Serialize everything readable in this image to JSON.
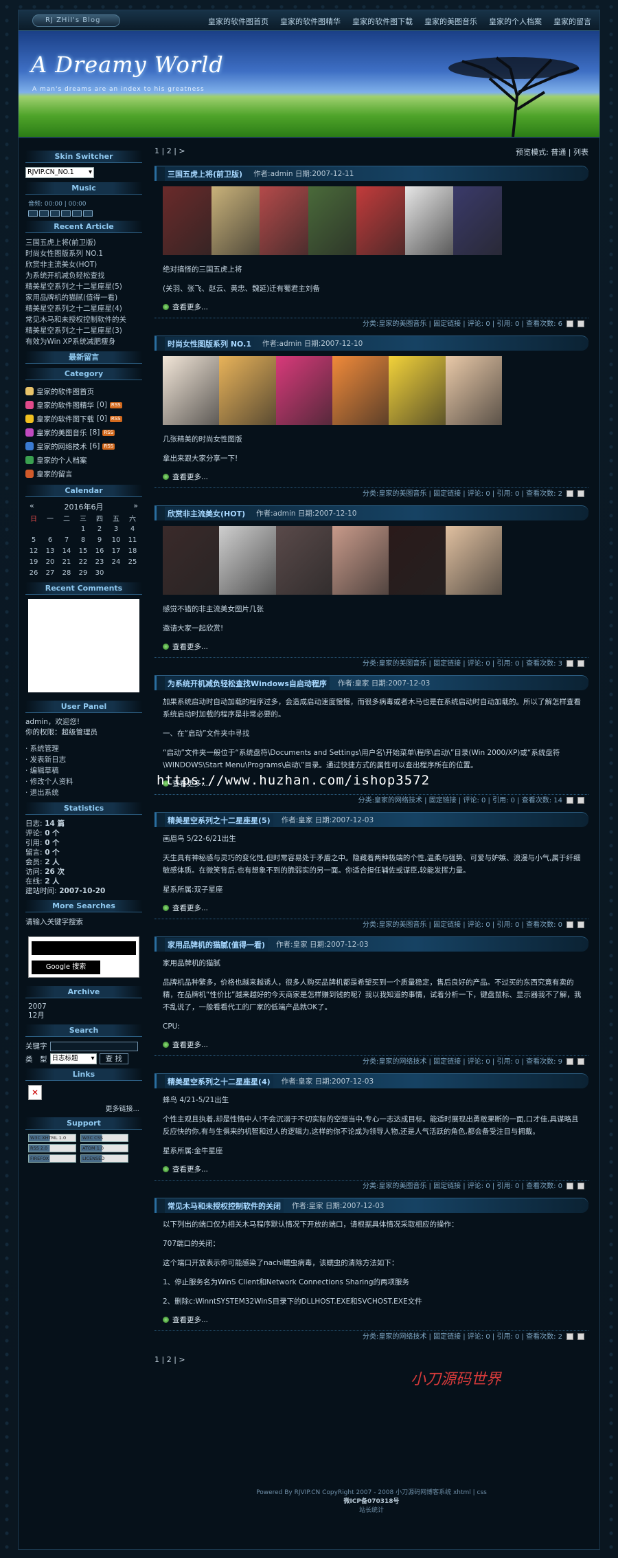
{
  "nav": {
    "logo": "RJ ZHiI's Blog",
    "links": [
      "皇家的软件图首页",
      "皇家的软件图精华",
      "皇家的软件图下载",
      "皇家的美图音乐",
      "皇家的个人档案",
      "皇家的留言"
    ]
  },
  "banner": {
    "title": "A Dreamy World",
    "tagline": "A man's dreams are an index to his greatness"
  },
  "sidebar": {
    "skin": {
      "heading": "Skin Switcher",
      "value": "RJVIP.CN_NO.1"
    },
    "music": {
      "heading": "Music",
      "status": "音频: 00:00 | 00:00"
    },
    "recent_article": {
      "heading": "Recent Article",
      "items": [
        "三国五虎上将(前卫版)",
        "时尚女性图版系列 NO.1",
        "欣赏非主流美女(HOT)",
        "为系统开机减负轻松查找",
        "精美星空系列之十二星座星(5)",
        "家用品牌机的猫腻(值得一看)",
        "精美星空系列之十二星座星(4)",
        "常见木马和未授权控制软件的关",
        "精美星空系列之十二星座星(3)",
        "有效为Win XP系统减肥瘦身"
      ]
    },
    "latest_msg": {
      "heading": "最新留言"
    },
    "category": {
      "heading": "Category",
      "items": [
        {
          "label": "皇家的软件图首页",
          "count": "",
          "color": "#e8c36a"
        },
        {
          "label": "皇家的软件图精华",
          "count": "[0]",
          "color": "#e04a8a"
        },
        {
          "label": "皇家的软件图下载",
          "count": "[0]",
          "color": "#f0c020"
        },
        {
          "label": "皇家的美图音乐",
          "count": "[8]",
          "color": "#c04ac0"
        },
        {
          "label": "皇家的网络技术",
          "count": "[6]",
          "color": "#3a7ad0"
        },
        {
          "label": "皇家的个人档案",
          "count": "",
          "color": "#3aa050"
        },
        {
          "label": "皇家的留言",
          "count": "",
          "color": "#d05a2a"
        }
      ]
    },
    "calendar": {
      "heading": "Calendar",
      "month": "2016年6月",
      "weekdays": [
        "日",
        "一",
        "二",
        "三",
        "四",
        "五",
        "六"
      ],
      "rows": [
        [
          "",
          "",
          "",
          "1",
          "2",
          "3",
          "4"
        ],
        [
          "5",
          "6",
          "7",
          "8",
          "9",
          "10",
          "11"
        ],
        [
          "12",
          "13",
          "14",
          "15",
          "16",
          "17",
          "18"
        ],
        [
          "19",
          "20",
          "21",
          "22",
          "23",
          "24",
          "25"
        ],
        [
          "26",
          "27",
          "28",
          "29",
          "30",
          "",
          ""
        ]
      ]
    },
    "recent_comments": {
      "heading": "Recent Comments"
    },
    "user_panel": {
      "heading": "User Panel",
      "welcome_user": "admin",
      "welcome_suffix": "，欢迎您!",
      "role": "你的权限：超级管理员",
      "links": [
        "系统管理",
        "发表新日志",
        "编辑草稿",
        "修改个人资料",
        "退出系统"
      ]
    },
    "statistics": {
      "heading": "Statistics",
      "rows": [
        {
          "label": "日志:",
          "value": "14 篇"
        },
        {
          "label": "评论:",
          "value": "0 个"
        },
        {
          "label": "引用:",
          "value": "0 个"
        },
        {
          "label": "留言:",
          "value": "0 个"
        },
        {
          "label": "会员:",
          "value": "2 人"
        },
        {
          "label": "访问:",
          "value": "26 次"
        },
        {
          "label": "在线:",
          "value": "2 人"
        },
        {
          "label": "建站时间:",
          "value": "2007-10-20"
        }
      ]
    },
    "more_searches": {
      "heading": "More Searches",
      "text": "请输入关键字搜索",
      "button": "Google 搜索"
    },
    "archive": {
      "heading": "Archive",
      "year": "2007",
      "month": "12月"
    },
    "search": {
      "heading": "Search",
      "keyword_label": "关键字",
      "type_label": "类　型",
      "type_value": "日志标题",
      "button": "查 找"
    },
    "links": {
      "heading": "Links",
      "more": "更多链接..."
    },
    "support": {
      "heading": "Support",
      "badges": [
        "W3C XHTML 1.0",
        "W3C CSS",
        "RSS 2.0",
        "ATOM 1.0",
        "FIREFOX",
        "LICENSED"
      ]
    }
  },
  "main": {
    "pager": "1 | 2 | >",
    "view_mode": "预览模式: 普通 | 列表",
    "more_label": "查看更多...",
    "posts": [
      {
        "title": "三国五虎上将(前卫版)",
        "meta": "作者:admin 日期:2007-12-11",
        "images": [
          "#6a2a2a",
          "#c9b27a",
          "#b44a4a",
          "#4a6a3a",
          "#c23b3b",
          "#e6e6e6",
          "#3a3a6a"
        ],
        "paras": [
          "绝对搞怪的三国五虎上将",
          "(关羽、张飞、赵云、黄忠、魏延)迁有蜀君主刘备"
        ],
        "footer": "分类:皇家的美图音乐 | 固定链接 | 评论: 0 | 引用: 0 | 查看次数: 6"
      },
      {
        "title": "时尚女性图版系列 NO.1",
        "meta": "作者:admin 日期:2007-12-10",
        "images": [
          "#f2e6d8",
          "#e8b35a",
          "#d83a7a",
          "#f08a3a",
          "#f2d23a",
          "#e9c9a8"
        ],
        "paras": [
          "几张精美的时尚女性图版",
          "拿出来跟大家分享一下!"
        ],
        "footer": "分类:皇家的美图音乐 | 固定链接 | 评论: 0 | 引用: 0 | 查看次数: 2"
      },
      {
        "title": "欣赏非主流美女(HOT)",
        "meta": "作者:admin 日期:2007-12-10",
        "images": [
          "#3a2a2a",
          "#cfcfcf",
          "#5a4a4a",
          "#c89a8a",
          "#2a1a1a",
          "#e0c0a0"
        ],
        "paras": [
          "感觉不错的非主流美女图片几张",
          "邀请大家一起欣赏!"
        ],
        "footer": "分类:皇家的美图音乐 | 固定链接 | 评论: 0 | 引用: 0 | 查看次数: 3"
      },
      {
        "title": "为系统开机减负轻松查找Windows自启动程序",
        "meta": "作者:皇家 日期:2007-12-03",
        "images": [],
        "paras": [
          "加果系统启动时自动加载的程序过多，会造成启动速度慢慢，而很多病毒或者木马也是在系统启动时自动加载的。所以了解怎样查看系统启动时加载的程序是非常必要的。",
          "一、在“启动”文件夹中寻找",
          "“启动”文件夹一般位于“系统盘符\\Documents and Settings\\用户名\\开始菜单\\程序\\启动\\”目录(Win 2000/XP)或“系统盘符\\WINDOWS\\Start Menu\\Programs\\启动\\”目录。通过快捷方式的属性可以查出程序所在的位置。"
        ],
        "footer": "分类:皇家的网络技术 | 固定链接 | 评论: 0 | 引用: 0 | 查看次数: 14"
      },
      {
        "title": "精美星空系列之十二星座星(5)",
        "meta": "作者:皇家 日期:2007-12-03",
        "images": [],
        "paras": [
          "画眉鸟 5/22-6/21出生",
          "天生具有神秘感与灵巧的变化性,但时常容易处于矛盾之中。隐藏着两种极端的个性,温柔与强势、可爱与妒嫉、浪漫与小气,属于纤细敏感体质。在微笑背后,也有想象不到的脆弱实的另一面。你适合担任辅佐或谋臣,较能发挥力量。",
          "星系所属:双子星座"
        ],
        "footer": "分类:皇家的美图音乐 | 固定链接 | 评论: 0 | 引用: 0 | 查看次数: 0"
      },
      {
        "title": "家用品牌机的猫腻(值得一看)",
        "meta": "作者:皇家 日期:2007-12-03",
        "images": [],
        "paras": [
          "家用品牌机的猫腻",
          "品牌机品种繁多，价格也越来越诱人，很多人购买品牌机都是希望买到一个质量稳定，售后良好的产品。不过买的东西究竟有卖的精，在品牌机“性价比”越来越好的今天商家是怎样赚到钱的呢？我以我知道的事情，试着分析一下，键盘鼠标、显示器我不了解，我不乱说了，一般看看代工的厂家的低端产品就OK了。",
          "CPU:"
        ],
        "footer": "分类:皇家的网络技术 | 固定链接 | 评论: 0 | 引用: 0 | 查看次数: 9"
      },
      {
        "title": "精美星空系列之十二星座星(4)",
        "meta": "作者:皇家 日期:2007-12-03",
        "images": [],
        "paras": [
          "蜂鸟 4/21-5/21出生",
          "个性主观且执着,却是性情中人!不会沉溺于不切实际的空想当中,专心一志达成目标。能适时展现出勇敢果断的一面,口才佳,具谋略且反应快的你,有与生俱来的机智和过人的逻辑力,这样的你不论成为领导人物,还是人气活跃的角色,都会备受注目与拥戴。",
          "星系所属:金牛星座"
        ],
        "footer": "分类:皇家的美图音乐 | 固定链接 | 评论: 0 | 引用: 0 | 查看次数: 0"
      },
      {
        "title": "常见木马和未授权控制软件的关闭",
        "meta": "作者:皇家 日期:2007-12-03",
        "images": [],
        "paras": [
          "以下列出的端口仅为相关木马程序默认情况下开放的端口，请根据具体情况采取相应的操作：",
          "707端口的关闭：",
          "这个端口开放表示你可能感染了nachi蠕虫病毒，该蠕虫的清除方法如下：",
          "1、停止服务名为WinS Client和Network Connections Sharing的两项服务",
          "2、删除c:WinntSYSTEM32WinS目录下的DLLHOST.EXE和SVCHOST.EXE文件"
        ],
        "footer": "分类:皇家的网络技术 | 固定链接 | 评论: 0 | 引用: 0 | 查看次数: 2"
      }
    ],
    "bottom_pager": "1 | 2 | >"
  },
  "footer": {
    "line1": "Powered By RJVIP.CN CopyRight 2007 - 2008 小刀源码网博客系统 xhtml | css",
    "line2": "微ICP备070318号",
    "line3": "站长统计"
  },
  "watermarks": {
    "url": "https://www.huzhan.com/ishop3572",
    "brand": "小刀源码世界"
  },
  "colors": {
    "accent": "#2a6ea0",
    "title_link": "#a8d8ff",
    "background": "#06111a"
  }
}
